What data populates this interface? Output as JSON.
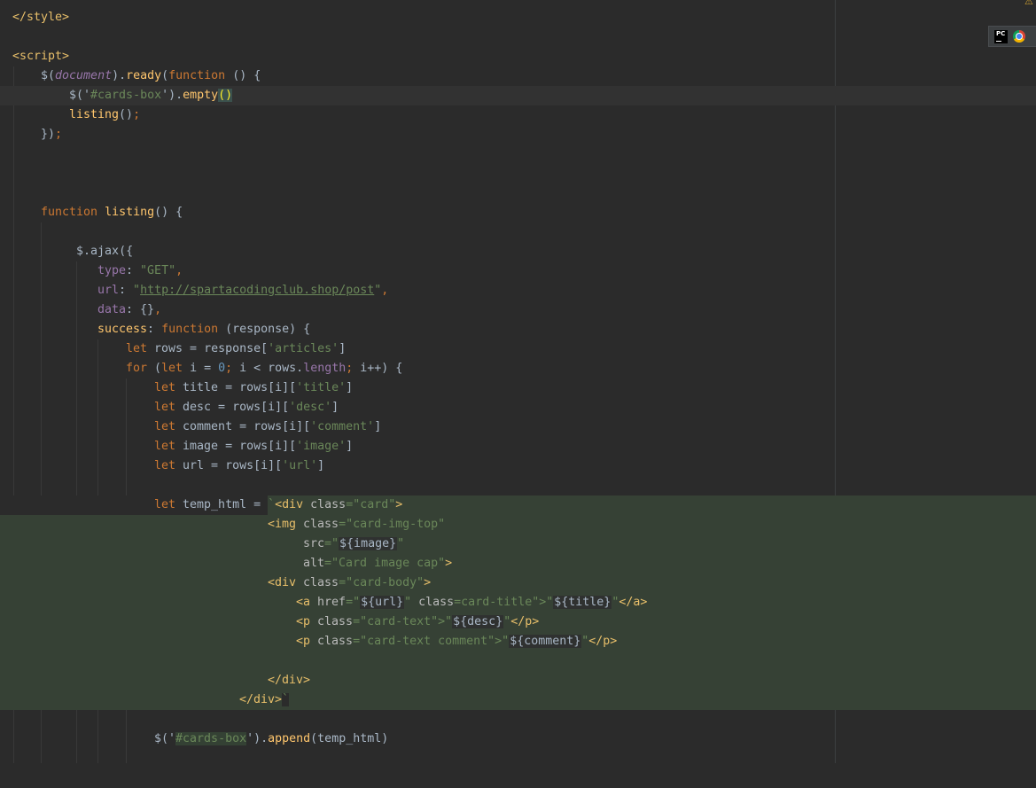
{
  "editor": {
    "lines": {
      "l1": {
        "t1": "</style>"
      },
      "l3": {
        "t1": "<script>"
      },
      "l4": {
        "t1": "$",
        "t2": "(",
        "t3": "document",
        "t4": ").",
        "t5": "ready",
        "t6": "(",
        "t7": "function",
        "t8": " () {"
      },
      "l5": {
        "t1": "$",
        "t2": "('",
        "t3": "#cards-box",
        "t4": "').",
        "t5": "empty",
        "t6": "()"
      },
      "l6": {
        "t1": "listing",
        "t2": "()",
        "t3": ";"
      },
      "l7": {
        "t1": "})",
        "t2": ";"
      },
      "l11": {
        "t1": "function ",
        "t2": "listing",
        "t3": "() {"
      },
      "l13": {
        "t1": "$",
        "t2": ".",
        "t3": "ajax",
        "t4": "({"
      },
      "l14": {
        "t1": "type",
        "t2": ": ",
        "t3": "\"GET\"",
        "t4": ","
      },
      "l15": {
        "t1": "url",
        "t2": ": ",
        "t3": "\"",
        "t4": "http://spartacodingclub.shop/post",
        "t5": "\"",
        "t6": ","
      },
      "l16": {
        "t1": "data",
        "t2": ": {}",
        "t3": ","
      },
      "l17": {
        "t1": "success",
        "t2": ": ",
        "t3": "function ",
        "t4": "(response) {"
      },
      "l18": {
        "t1": "let ",
        "t2": "rows = response[",
        "t3": "'articles'",
        "t4": "]"
      },
      "l19": {
        "t1": "for ",
        "t2": "(",
        "t3": "let ",
        "t4": "i = ",
        "t5": "0",
        "t6": "; ",
        "t7": "i < rows.",
        "t8": "length",
        "t9": "; ",
        "t10": "i++) {"
      },
      "l20": {
        "t1": "let ",
        "t2": "title = rows[i][",
        "t3": "'title'",
        "t4": "]"
      },
      "l21": {
        "t1": "let ",
        "t2": "desc = rows[i][",
        "t3": "'desc'",
        "t4": "]"
      },
      "l22": {
        "t1": "let ",
        "t2": "comment = rows[i][",
        "t3": "'comment'",
        "t4": "]"
      },
      "l23": {
        "t1": "let ",
        "t2": "image = rows[i][",
        "t3": "'image'",
        "t4": "]"
      },
      "l24": {
        "t1": "let ",
        "t2": "url = rows[i][",
        "t3": "'url'",
        "t4": "]"
      },
      "l26": {
        "t1": "let ",
        "t2": "temp_html = ",
        "t3": "`",
        "t4": "<div ",
        "t5": "class",
        "t6": "=\"card\"",
        "t7": ">"
      },
      "l27": {
        "t1": "<img ",
        "t2": "class",
        "t3": "=\"card-img-top\""
      },
      "l28": {
        "t1": "src",
        "t2": "=\"",
        "t3": "${image}",
        "t4": "\""
      },
      "l29": {
        "t1": "alt",
        "t2": "=\"Card image cap\"",
        "t3": ">"
      },
      "l30": {
        "t1": "<div ",
        "t2": "class",
        "t3": "=\"card-body\"",
        "t4": ">"
      },
      "l31": {
        "t1": "<a ",
        "t2": "href",
        "t3": "=\"",
        "t4": "${url}",
        "t5": "\" ",
        "t6": "class",
        "t7": "=card-title\"",
        "t8": ">\"",
        "t9": "${title}",
        "t10": "\"",
        "t11": "</a>"
      },
      "l32": {
        "t1": "<p ",
        "t2": "class",
        "t3": "=\"card-text\"",
        "t4": ">\"",
        "t5": "${desc}",
        "t6": "\"",
        "t7": "</p>"
      },
      "l33": {
        "t1": "<p ",
        "t2": "class",
        "t3": "=\"card-text comment\"",
        "t4": ">\"",
        "t5": "${comment}",
        "t6": "\"",
        "t7": "</p>"
      },
      "l35": {
        "t1": "</div>"
      },
      "l36": {
        "t1": "</div>",
        "t2": "`"
      },
      "l38": {
        "t1": "$",
        "t2": "('",
        "t3": "#cards-box",
        "t4": "').",
        "t5": "append",
        "t6": "(temp_html)"
      }
    }
  },
  "toolbar": {
    "icons": [
      "pycharm-icon",
      "chrome-icon"
    ]
  },
  "status": {
    "warning": "⚠"
  },
  "colors": {
    "background": "#2b2b2b",
    "keyword": "#cc7832",
    "string": "#6a8759",
    "tag": "#e8bf6a",
    "function": "#ffc66d",
    "injected_language_bg": "#364135"
  }
}
